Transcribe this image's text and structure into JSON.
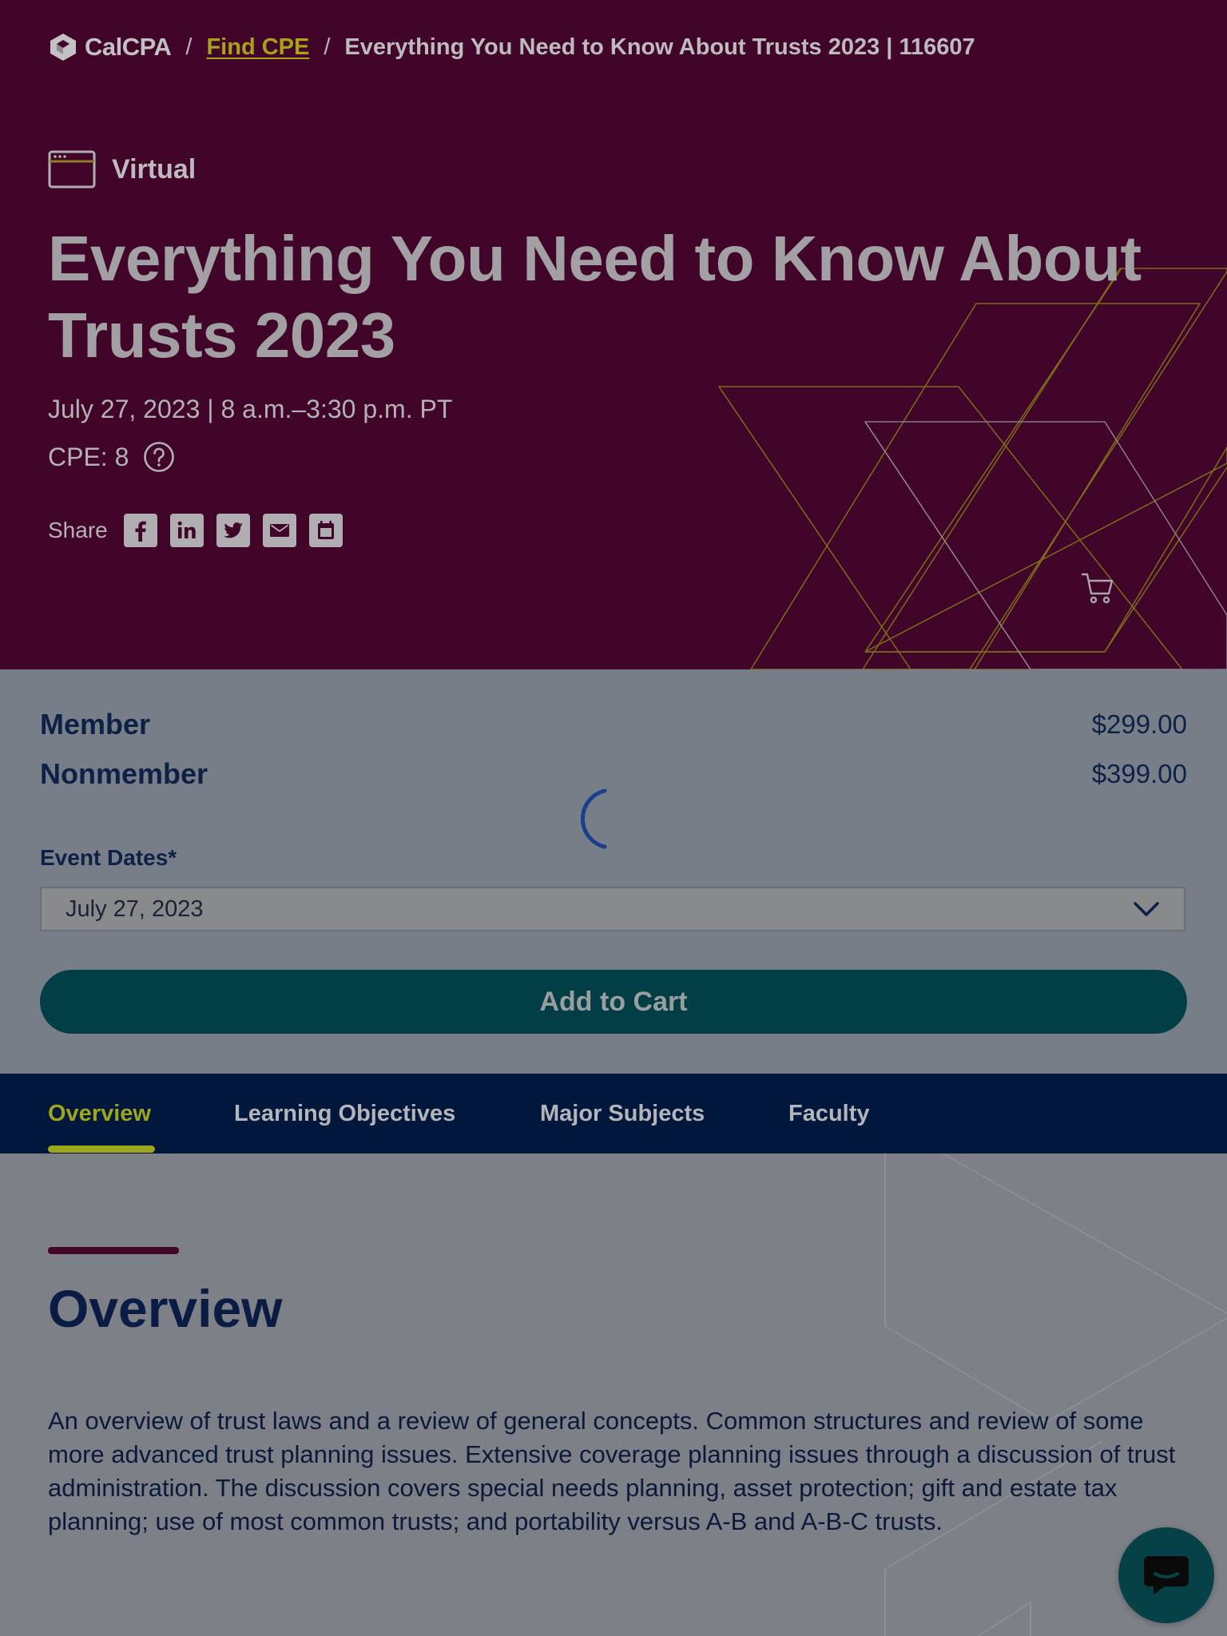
{
  "colors": {
    "hero_bg": "#41052a",
    "accent_green": "#9ca51c",
    "navy": "#0d2046",
    "teal_button": "#023e45",
    "tabs_bg": "#01173b"
  },
  "breadcrumb": {
    "logo_text": "CalCPA",
    "logo_icon": "calcpa-cube-icon",
    "separator": "/",
    "link_label": "Find CPE",
    "current": "Everything You Need to Know About Trusts 2023 | 116607"
  },
  "event": {
    "format_label": "Virtual",
    "format_icon": "browser-window-icon",
    "title": "Everything You Need to Know About Trusts 2023",
    "date_time": "July 27, 2023 | 8 a.m.–3:30 p.m. PT",
    "cpe_label": "CPE: 8",
    "help_icon": "question-circle-icon",
    "share_label": "Share",
    "share_icons": [
      "facebook-icon",
      "linkedin-icon",
      "twitter-icon",
      "email-icon",
      "calendar-icon"
    ],
    "cart_icon": "cart-icon"
  },
  "pricing": {
    "member_label": "Member",
    "member_price": "$299.00",
    "nonmember_label": "Nonmember",
    "nonmember_price": "$399.00",
    "event_dates_label": "Event Dates*",
    "selected_date": "July 27, 2023",
    "add_to_cart": "Add to Cart"
  },
  "tabs": [
    {
      "label": "Overview",
      "active": true
    },
    {
      "label": "Learning Objectives",
      "active": false
    },
    {
      "label": "Major Subjects",
      "active": false
    },
    {
      "label": "Faculty",
      "active": false
    }
  ],
  "overview": {
    "heading": "Overview",
    "body": "An overview of trust laws and a review of general concepts. Common structures and review of some more advanced trust planning issues. Extensive coverage planning issues through a discussion of trust administration. The discussion covers special needs planning, asset protection; gift and estate tax planning; use of most common trusts; and portability versus A-B and A-B-C trusts."
  },
  "chat": {
    "icon": "chat-bubble-icon"
  }
}
